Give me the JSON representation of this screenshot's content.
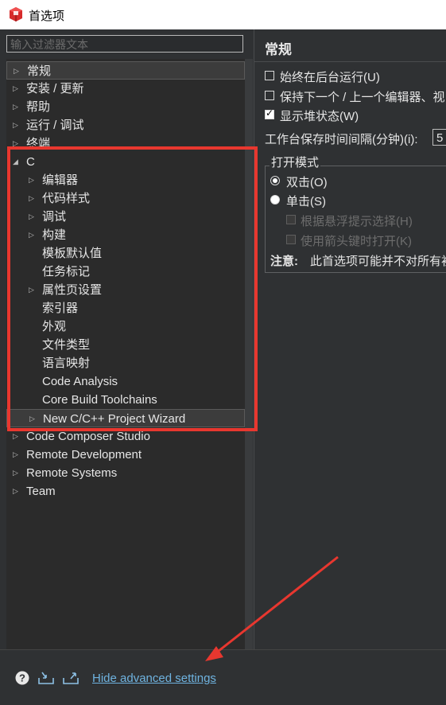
{
  "window": {
    "title": "首选项"
  },
  "filter": {
    "placeholder": "输入过滤器文本"
  },
  "tree": {
    "items": [
      {
        "label": "常规",
        "arrow": "▷",
        "level": 0,
        "selected": true
      },
      {
        "label": "安装 / 更新",
        "arrow": "▷",
        "level": 0
      },
      {
        "label": "帮助",
        "arrow": "▷",
        "level": 0
      },
      {
        "label": "运行 / 调试",
        "arrow": "▷",
        "level": 0
      },
      {
        "label": "终端",
        "arrow": "▷",
        "level": 0
      },
      {
        "label": "C",
        "arrow": "◢",
        "level": 0
      },
      {
        "label": "编辑器",
        "arrow": "▷",
        "level": 1
      },
      {
        "label": "代码样式",
        "arrow": "▷",
        "level": 1
      },
      {
        "label": "调试",
        "arrow": "▷",
        "level": 1
      },
      {
        "label": "构建",
        "arrow": "▷",
        "level": 1
      },
      {
        "label": "模板默认值",
        "arrow": "",
        "level": 1
      },
      {
        "label": "任务标记",
        "arrow": "",
        "level": 1
      },
      {
        "label": "属性页设置",
        "arrow": "▷",
        "level": 1
      },
      {
        "label": "索引器",
        "arrow": "",
        "level": 1
      },
      {
        "label": "外观",
        "arrow": "",
        "level": 1
      },
      {
        "label": "文件类型",
        "arrow": "",
        "level": 1
      },
      {
        "label": "语言映射",
        "arrow": "",
        "level": 1
      },
      {
        "label": "Code Analysis",
        "arrow": "",
        "level": 1
      },
      {
        "label": "Core Build Toolchains",
        "arrow": "",
        "level": 1
      },
      {
        "label": "New C/C++ Project Wizard",
        "arrow": "▷",
        "level": 1,
        "selected": true
      },
      {
        "label": "Code Composer Studio",
        "arrow": "▷",
        "level": 0
      },
      {
        "label": "Remote Development",
        "arrow": "▷",
        "level": 0
      },
      {
        "label": "Remote Systems",
        "arrow": "▷",
        "level": 0
      },
      {
        "label": "Team",
        "arrow": "▷",
        "level": 0
      }
    ]
  },
  "right": {
    "title": "常规",
    "options": [
      {
        "label": "始终在后台运行(U)",
        "checked": false
      },
      {
        "label": "保持下一个 / 上一个编辑器、视",
        "checked": false
      },
      {
        "label": "显示堆状态(W)",
        "checked": true
      }
    ],
    "interval_label": "工作台保存时间间隔(分钟)(i):",
    "interval_value": "5",
    "open_mode": {
      "title": "打开模式",
      "double_click": "双击(O)",
      "single_click": "单击(S)",
      "hover_select": "根据悬浮提示选择(H)",
      "arrow_open": "使用箭头键时打开(K)",
      "note_label": "注意:",
      "note_text": "此首选项可能并不对所有初"
    }
  },
  "bottom": {
    "help_icon": "help-icon",
    "import_icon": "import-icon",
    "export_icon": "export-icon",
    "link": "Hide advanced settings"
  },
  "colors": {
    "annotation": "#e8372f",
    "link": "#6fb3e0"
  }
}
